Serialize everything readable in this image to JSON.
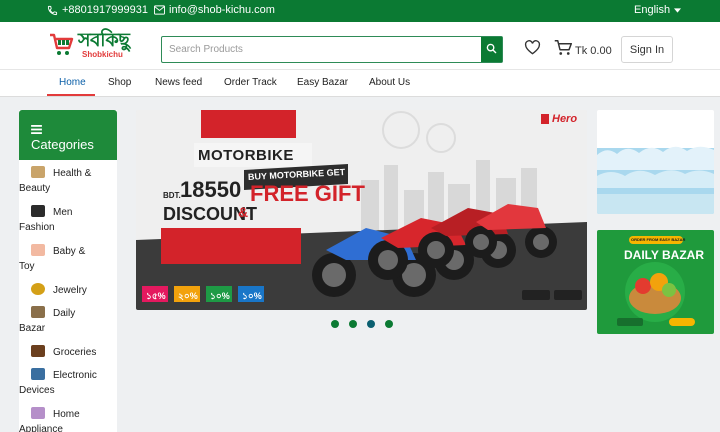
{
  "topbar": {
    "phone": "+8801917999931",
    "email": "info@shob-kichu.com",
    "language": "English"
  },
  "header": {
    "logo_text": "সবকিছু",
    "logo_sub": "Shobkichu",
    "search_placeholder": "Search Products",
    "cart_amount": "Tk 0.00",
    "signin_label": "Sign In"
  },
  "nav": {
    "items": [
      "Home",
      "Shop",
      "News feed",
      "Order Track",
      "Easy Bazar",
      "About Us"
    ],
    "active_index": 0
  },
  "sidebar": {
    "title": "Categories",
    "items": [
      {
        "line1": "Health &",
        "line2": "Beauty"
      },
      {
        "line1": "Men",
        "line2": "Fashion"
      },
      {
        "line1": "Baby &",
        "line2": "Toy"
      },
      {
        "line1": "Jewelry",
        "line2": ""
      },
      {
        "line1": "Daily",
        "line2": "Bazar"
      },
      {
        "line1": "Groceries",
        "line2": ""
      },
      {
        "line1": "Electronic",
        "line2": "Devices"
      },
      {
        "line1": "Home",
        "line2": "Appliance"
      }
    ]
  },
  "banner": {
    "brand": "Hero",
    "headline": "MOTORBIKE",
    "price_prefix": "BDT.",
    "price": "18550",
    "ribbon": "BUY MOTORBIKE GET",
    "discount": "DISCOUNT",
    "amp": "&",
    "free_gift": "FREE GIFT",
    "tags": [
      "১৫%",
      "২০%",
      "১০%",
      "১০%"
    ],
    "slide_count": 4,
    "active_slide": 2
  },
  "side_ads": {
    "ad2_top": "ORDER FROM EASY BAZAR",
    "ad2_title": "DAILY BAZAR"
  },
  "colors": {
    "brand_green": "#0b7a33",
    "accent_red": "#e23b3b",
    "nav_active": "#0b5fa8"
  },
  "icons": [
    "phone-icon",
    "mail-icon",
    "caret-down-icon",
    "cart-logo-icon",
    "search-icon",
    "heart-icon",
    "cart-icon",
    "menu-icon"
  ]
}
